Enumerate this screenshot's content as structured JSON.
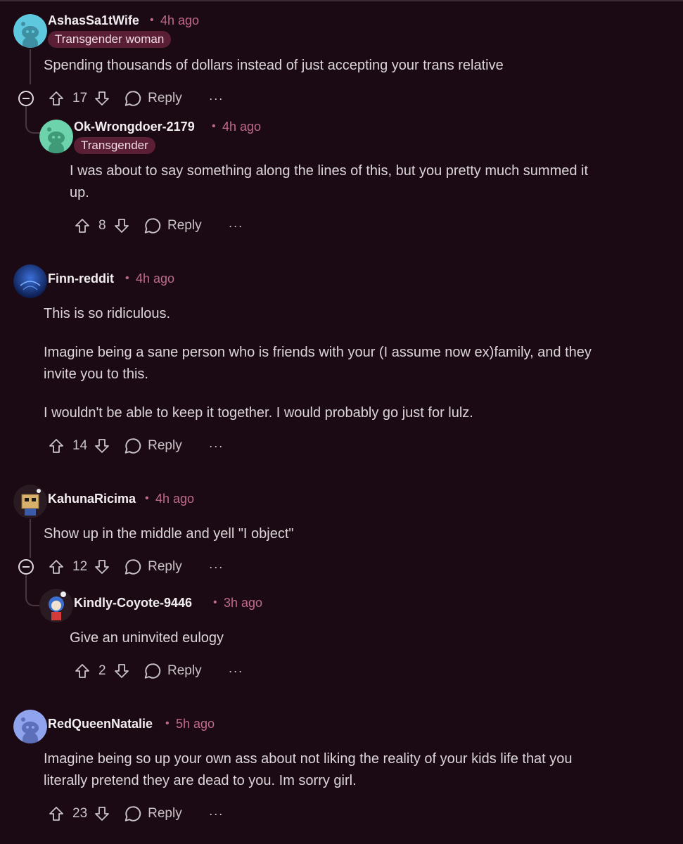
{
  "comments": [
    {
      "username": "AshasSa1tWife",
      "time": "4h ago",
      "flair": "Transgender woman",
      "body": [
        "Spending thousands of dollars instead of just accepting your trans relative"
      ],
      "score": "17",
      "reply_label": "Reply",
      "more_label": "···",
      "avatar_color": "#5ec8de",
      "reply": {
        "username": "Ok-Wrongdoer-2179",
        "time": "4h ago",
        "flair": "Transgender",
        "body": [
          "I was about to say something along the lines of this, but you pretty much summed it",
          "up."
        ],
        "score": "8",
        "reply_label": "Reply",
        "more_label": "···",
        "avatar_color": "#6dd3ad"
      }
    },
    {
      "username": "Finn-reddit",
      "time": "4h ago",
      "body": [
        "This is so ridiculous.",
        "Imagine being a sane person who is friends with your (I assume now ex)family, and they",
        "invite you to this.",
        "I wouldn't be able to keep it together. I would probably go just for lulz."
      ],
      "score": "14",
      "reply_label": "Reply",
      "more_label": "···"
    },
    {
      "username": "KahunaRicima",
      "time": "4h ago",
      "body": [
        "Show up in the middle and yell \"I object\""
      ],
      "score": "12",
      "reply_label": "Reply",
      "more_label": "···",
      "reply": {
        "username": "Kindly-Coyote-9446",
        "time": "3h ago",
        "body": [
          "Give an uninvited eulogy"
        ],
        "score": "2",
        "reply_label": "Reply",
        "more_label": "···"
      }
    },
    {
      "username": "RedQueenNatalie",
      "time": "5h ago",
      "body": [
        "Imagine being so up your own ass about not liking the reality of your kids life that you",
        "literally pretend they are dead to you. Im sorry girl."
      ],
      "score": "23",
      "reply_label": "Reply",
      "more_label": "···",
      "avatar_color": "#8fa4ec"
    }
  ],
  "icons": {
    "upvote": "arrow-up-icon",
    "downvote": "arrow-down-icon",
    "reply": "speech-bubble-icon",
    "collapse": "minus-circle-icon"
  },
  "colors": {
    "background": "#1b0a14",
    "timestamp": "#c06a8c",
    "flair_bg": "#5a1e35"
  }
}
